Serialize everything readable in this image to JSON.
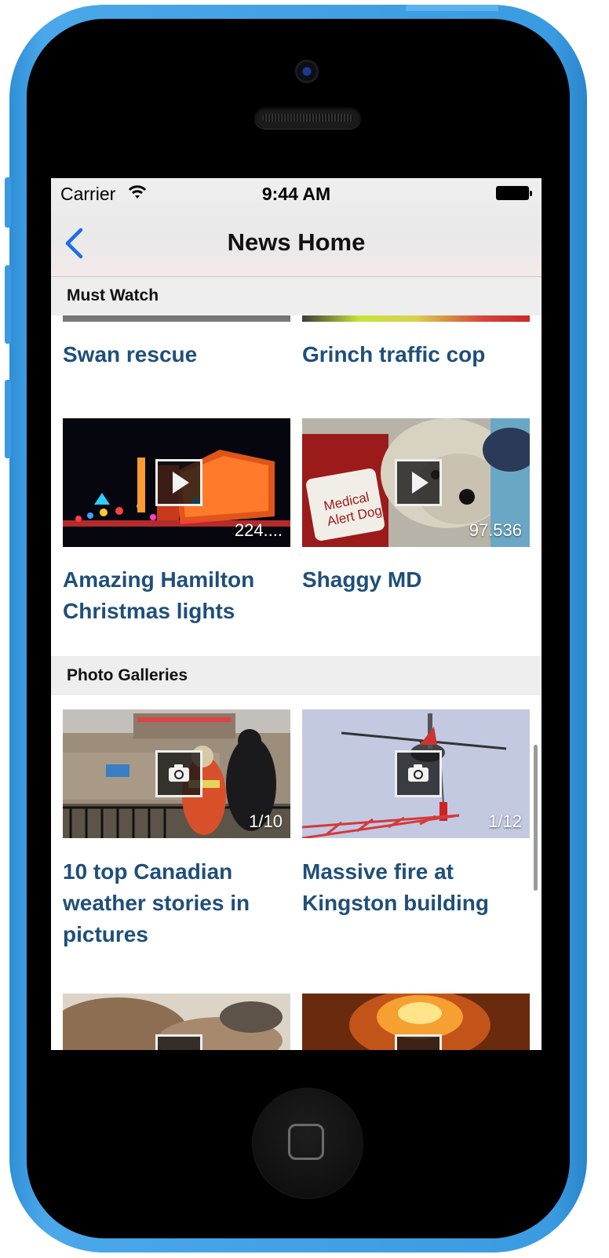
{
  "status_bar": {
    "carrier": "Carrier",
    "time": "9:44 AM"
  },
  "nav": {
    "title": "News Home",
    "back_icon": "chevron-left-icon"
  },
  "sections": {
    "must_watch": {
      "header": "Must Watch",
      "items": [
        {
          "title": "Swan rescue"
        },
        {
          "title": "Grinch traffic cop"
        },
        {
          "title": "Amazing Hamilton Christmas lights",
          "count": "224...."
        },
        {
          "title": "Shaggy MD",
          "count": "97.536"
        }
      ]
    },
    "photo_galleries": {
      "header": "Photo Galleries",
      "items": [
        {
          "title": "10 top Canadian weather stories in pictures",
          "count": "1/10"
        },
        {
          "title": "Massive fire at Kingston building",
          "count": "1/12"
        }
      ]
    }
  },
  "colors": {
    "phone_body": "#3a9be0",
    "title_text": "#1f4f79",
    "nav_accent": "#1a6ee8"
  }
}
